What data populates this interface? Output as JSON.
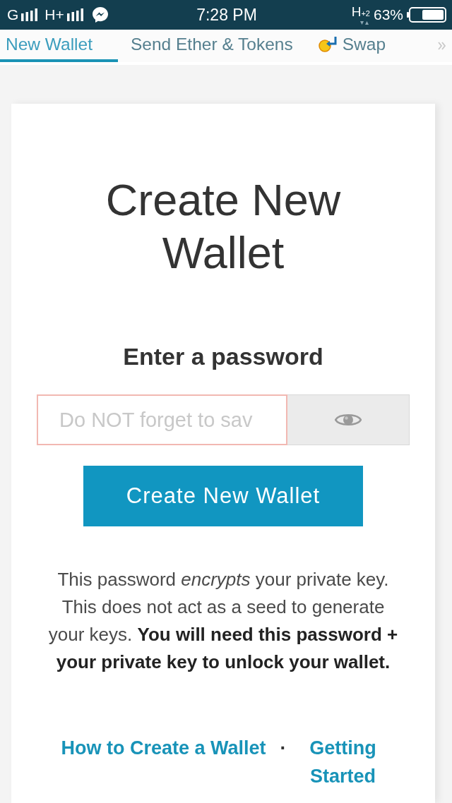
{
  "status_bar": {
    "network_1": "G",
    "network_2": "H+",
    "time": "7:28 PM",
    "data_type": "H$_{+2}$",
    "battery": "63%"
  },
  "tabs": [
    {
      "label": "New Wallet",
      "selected": true,
      "kind": "text"
    },
    {
      "label": "Send Ether & Tokens",
      "selected": false,
      "kind": "text"
    },
    {
      "label": "Swap",
      "selected": false,
      "kind": "icon"
    }
  ],
  "card": {
    "title": "Create New Wallet",
    "password_heading": "Enter a password",
    "password_field": {
      "placeholder": "Do NOT forget to sav"
    },
    "create_button": "Create New Wallet",
    "note": "This password *encrypts* your private key. This does not act as a seed to generate your keys. **You will need this password + your private key to unlock your wallet.**",
    "links": [
      {
        "label": "How to Create a Wallet"
      },
      {
        "label": "Getting Started"
      }
    ],
    "separator": "·"
  }
}
